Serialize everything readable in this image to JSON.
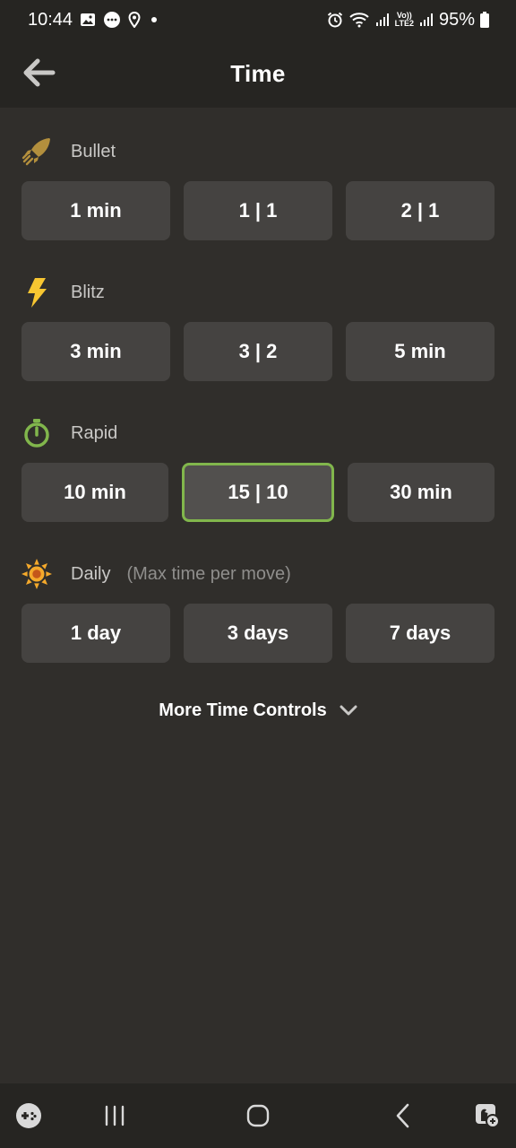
{
  "status_bar": {
    "time": "10:44",
    "battery_percent": "95%",
    "icons": [
      "gallery-icon",
      "chat-icon",
      "location-icon",
      "dot-icon",
      "alarm-icon",
      "wifi-icon",
      "signal-icon",
      "volte-icon",
      "signal-icon",
      "battery-icon"
    ],
    "volte_line1": "Vo))",
    "volte_line2": "LTE2"
  },
  "header": {
    "title": "Time",
    "back_icon": "arrow-left-icon"
  },
  "sections": [
    {
      "name": "Bullet",
      "icon": "bullet-rocket-icon",
      "icon_color": "#b38f3d",
      "options": [
        "1 min",
        "1 | 1",
        "2 | 1"
      ]
    },
    {
      "name": "Blitz",
      "icon": "lightning-bolt-icon",
      "icon_color": "#f7c631",
      "options": [
        "3 min",
        "3 | 2",
        "5 min"
      ]
    },
    {
      "name": "Rapid",
      "icon": "stopwatch-icon",
      "icon_color": "#81b64c",
      "options": [
        "10 min",
        "15 | 10",
        "30 min"
      ],
      "selected": "15 | 10"
    },
    {
      "name": "Daily",
      "note": "(Max time per move)",
      "icon": "sun-icon",
      "icon_color": "#f4a92b",
      "options": [
        "1 day",
        "3 days",
        "7 days"
      ]
    }
  ],
  "more_controls": {
    "label": "More Time Controls",
    "icon": "chevron-down-icon"
  },
  "nav_bar": {
    "items": [
      "game-controller-icon",
      "recent-apps-icon",
      "home-icon",
      "back-icon",
      "assistant-icon"
    ]
  },
  "colors": {
    "background": "#302e2b",
    "bar_background": "#262522",
    "button_background": "#454341",
    "selected_border": "#81b64c"
  }
}
